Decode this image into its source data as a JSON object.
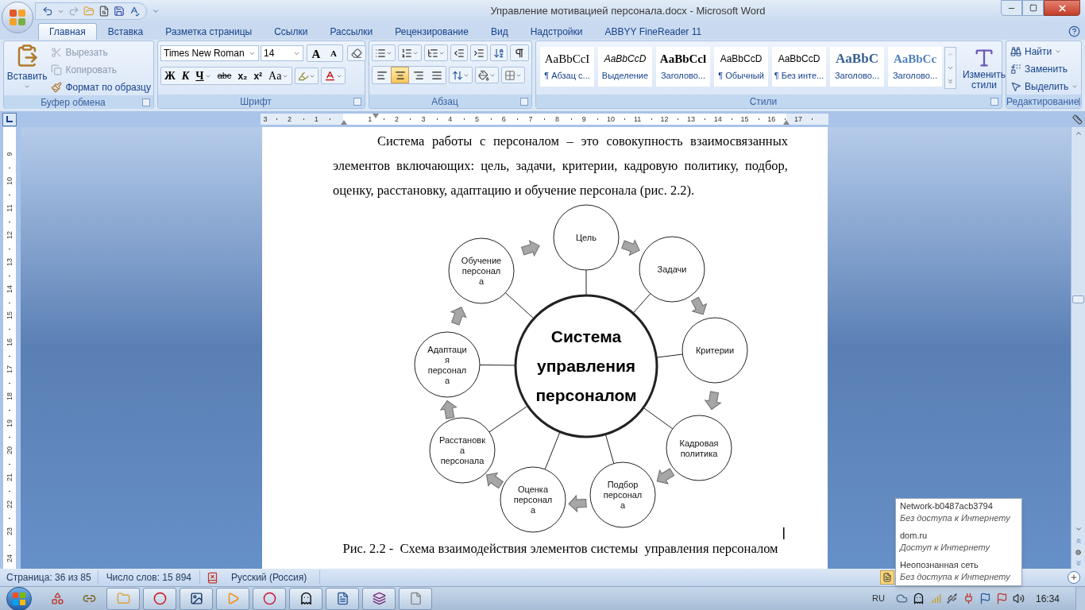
{
  "window": {
    "title": "Управление мотивацией персонала.docx - Microsoft Word"
  },
  "tabs": [
    {
      "label": "Главная",
      "selected": true
    },
    {
      "label": "Вставка",
      "selected": false
    },
    {
      "label": "Разметка страницы",
      "selected": false
    },
    {
      "label": "Ссылки",
      "selected": false
    },
    {
      "label": "Рассылки",
      "selected": false
    },
    {
      "label": "Рецензирование",
      "selected": false
    },
    {
      "label": "Вид",
      "selected": false
    },
    {
      "label": "Надстройки",
      "selected": false
    },
    {
      "label": "ABBYY FineReader 11",
      "selected": false
    }
  ],
  "clipboard": {
    "title": "Буфер обмена",
    "paste": "Вставить",
    "items": [
      {
        "label": "Вырезать",
        "kind": "cut",
        "disabled": true
      },
      {
        "label": "Копировать",
        "kind": "copy",
        "disabled": true
      },
      {
        "label": "Формат по образцу",
        "kind": "format-painter",
        "disabled": false
      }
    ]
  },
  "font": {
    "title": "Шрифт",
    "family": "Times New Roman",
    "size": "14",
    "size_buttons": [
      {
        "label": "A",
        "kind": "grow"
      },
      {
        "label": "A",
        "kind": "shrink"
      }
    ],
    "format_buttons": [
      {
        "label": "Ж",
        "kind": "bold"
      },
      {
        "label": "К",
        "kind": "italic"
      },
      {
        "label": "Ч",
        "kind": "underline"
      },
      {
        "label": "abc",
        "kind": "strike"
      },
      {
        "label": "x₂",
        "kind": "sub"
      },
      {
        "label": "x²",
        "kind": "super"
      },
      {
        "label": "Aa",
        "kind": "case"
      }
    ]
  },
  "paragraph": {
    "title": "Абзац",
    "alignments": [
      {
        "kind": "left",
        "selected": false
      },
      {
        "kind": "center",
        "selected": true
      },
      {
        "kind": "right",
        "selected": false
      },
      {
        "kind": "justify",
        "selected": false
      }
    ]
  },
  "styles": {
    "title": "Стили",
    "change_button": "Изменить стили",
    "items": [
      {
        "sample": "AaBbCcI",
        "label": "¶ Абзац с...",
        "kind": "serif"
      },
      {
        "sample": "AaBbCcD",
        "label": "Выделение",
        "kind": "italic"
      },
      {
        "sample": "AaBbCcl",
        "label": "Заголово...",
        "kind": "serif-bold"
      },
      {
        "sample": "AaBbCcD",
        "label": "¶ Обычный",
        "kind": "sans"
      },
      {
        "sample": "AaBbCcD",
        "label": "¶ Без инте...",
        "kind": "sans"
      },
      {
        "sample": "AaBbC",
        "label": "Заголово...",
        "kind": "heading"
      },
      {
        "sample": "AaBbCc",
        "label": "Заголово...",
        "kind": "subheading"
      }
    ]
  },
  "editing": {
    "title": "Редактирование",
    "items": [
      {
        "label": "Найти",
        "kind": "find"
      },
      {
        "label": "Заменить",
        "kind": "replace"
      },
      {
        "label": "Выделить",
        "kind": "select"
      }
    ]
  },
  "ruler": {
    "horizontal": [
      "3",
      "2",
      "1",
      "1",
      "2",
      "3",
      "4",
      "5",
      "6",
      "7",
      "8",
      "9",
      "10",
      "11",
      "12",
      "13",
      "14",
      "15",
      "16",
      "17"
    ],
    "vertical": [
      "9",
      "10",
      "11",
      "12",
      "13",
      "14",
      "15",
      "16",
      "17",
      "18",
      "19",
      "20",
      "21",
      "22",
      "23",
      "24"
    ]
  },
  "document": {
    "paragraph": "Система работы с персоналом – это совокупность взаимосвязанных элементов включающих: цель, задачи, критерии, кадровую политику, подбор, оценку, расстановку, адаптацию и обучение персонала (рис. 2.2).",
    "diagram": {
      "center": [
        "Система",
        "управления",
        "персоналом"
      ],
      "nodes": [
        {
          "lines": [
            "Цель"
          ]
        },
        {
          "lines": [
            "Обучение",
            "персонал",
            "а"
          ]
        },
        {
          "lines": [
            "Задачи"
          ]
        },
        {
          "lines": [
            "Адаптаци",
            "я",
            "персонал",
            "а"
          ]
        },
        {
          "lines": [
            "Критерии"
          ]
        },
        {
          "lines": [
            "Расстановк",
            "а",
            "персонала"
          ]
        },
        {
          "lines": [
            "Кадровая",
            "политика"
          ]
        },
        {
          "lines": [
            "Оценка",
            "персонал",
            "а"
          ]
        },
        {
          "lines": [
            "Подбор",
            "персонал",
            "а"
          ]
        }
      ]
    },
    "caption": "Рис. 2.2 -  Схема взаимодействия элементов системы  управления персоналом"
  },
  "status_bar": {
    "page": "Страница: 36 из 85",
    "words": "Число слов: 15 894",
    "language": "Русский (Россия)"
  },
  "taskbar": {
    "language": "RU",
    "clock": "16:34"
  },
  "network_popup": [
    {
      "name": "Network-b0487acb3794",
      "status": "Без доступа к Интернету"
    },
    {
      "name": "dom.ru",
      "status": "Доступ к Интернету"
    },
    {
      "name": "Неопознанная сеть",
      "status": "Без доступа к Интернету"
    }
  ]
}
